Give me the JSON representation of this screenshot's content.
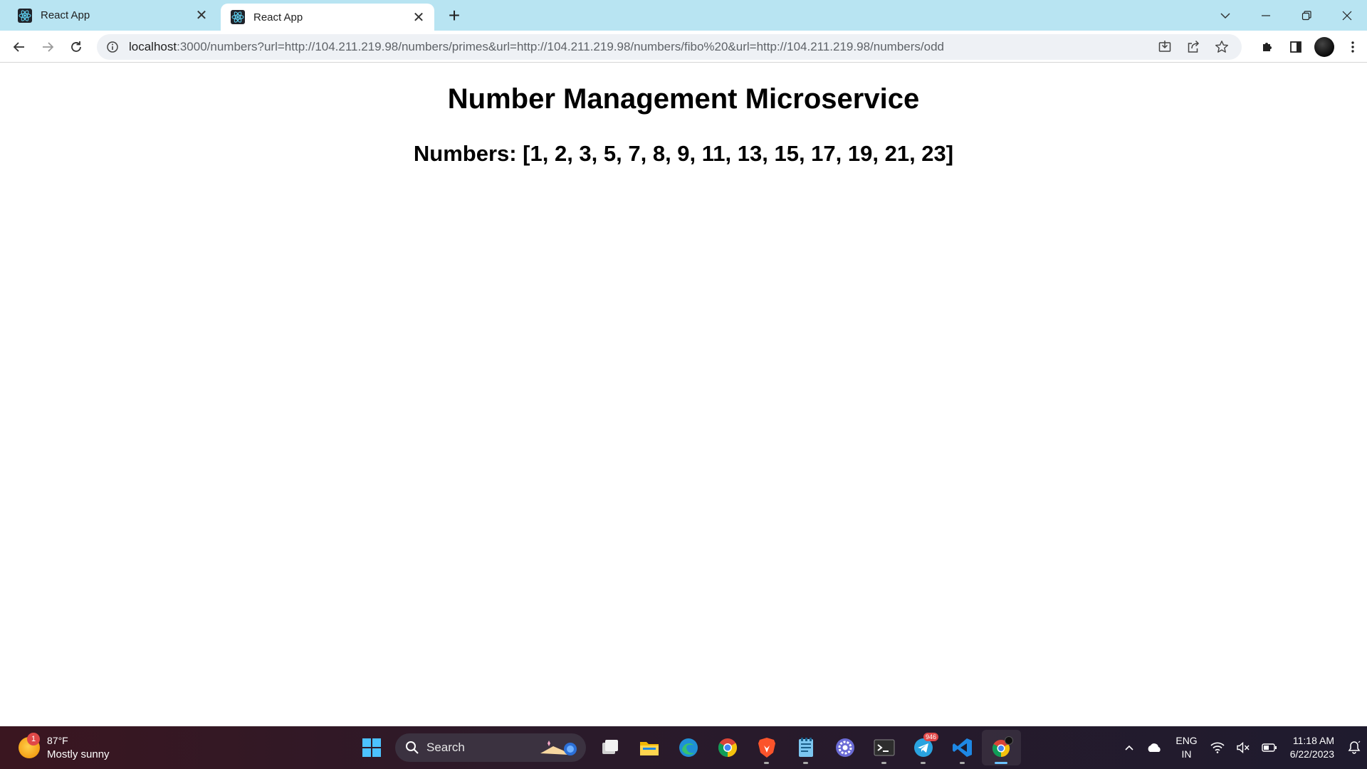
{
  "browser": {
    "tabs": [
      {
        "title": "React App",
        "active": false
      },
      {
        "title": "React App",
        "active": true
      }
    ],
    "url_host": "localhost",
    "url_rest": ":3000/numbers?url=http://104.211.219.98/numbers/primes&url=http://104.211.219.98/numbers/fibo%20&url=http://104.211.219.98/numbers/odd"
  },
  "page": {
    "heading": "Number Management Microservice",
    "numbers_line": "Numbers: [1, 2, 3, 5, 7, 8, 9, 11, 13, 15, 17, 19, 21, 23]"
  },
  "taskbar": {
    "weather": {
      "badge": "1",
      "temperature": "87°F",
      "condition": "Mostly sunny"
    },
    "search_label": "Search",
    "telegram_badge": "946",
    "language": {
      "line1": "ENG",
      "line2": "IN"
    },
    "clock": {
      "time": "11:18 AM",
      "date": "6/22/2023"
    }
  },
  "colors": {
    "tabstrip": "#b8e4f2",
    "omnibox": "#eef1f5",
    "taskbar": "#2b1a2a",
    "accent": "#6cc3ff"
  }
}
